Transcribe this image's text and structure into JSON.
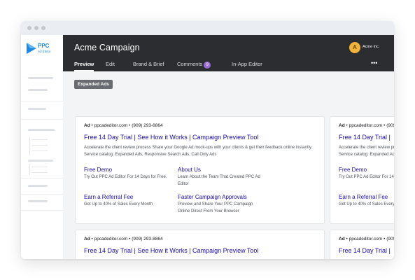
{
  "window": {
    "dots": [
      "dot",
      "dot",
      "dot"
    ]
  },
  "sidebar": {
    "logo": {
      "text_top": "PPC",
      "text_bottom": "Ad Editor",
      "brand_color": "#1e88e5"
    }
  },
  "header": {
    "title": "Acme Campaign",
    "brand": {
      "name": "Acme Inc.",
      "logo_color": "#f2b33a"
    },
    "more_label": "•••",
    "tabs": [
      {
        "label": "Preview",
        "active": true
      },
      {
        "label": "Edit"
      },
      {
        "label": "Brand & Brief"
      },
      {
        "label": "Comments",
        "badge": "9"
      },
      {
        "label": "In-App Editor"
      }
    ]
  },
  "content": {
    "section_chip": "Expanded Ads",
    "ad": {
      "ad_label": "Ad",
      "separator": "•",
      "url": "ppcadeditor.com",
      "phone": "(909) 293-8864",
      "headline": "Free 14 Day Trial | See How it Works | Campaign Preview Tool",
      "description": "Accelerate the client review process Share your Google Ad mock-ups with your clients & get their feedback online instantly. Service catalog: Expanded Ads, Responsive Search Ads, Call Only Ads",
      "sitelinks": [
        {
          "title": "Free Demo",
          "text": "Try Out PPC Ad Editor For 14 Days for Free."
        },
        {
          "title": "About Us",
          "text": "Learn About the Team That Created PPC Ad Editor"
        },
        {
          "title": "Earn a Referral Fee",
          "text": "Get Up to 40% of Sales Every Month"
        },
        {
          "title": "Faster Campaign Approvals",
          "text": "Preview and Share Your PPC Campaign Online Direct From Your Browser"
        }
      ]
    },
    "ad_partial_headline": "Free 14 Day Trial |",
    "ad_partial_desc": "Accelerate the client review process Share your Google Ad mock-ups with your clients & get their feedback online instantly. Service catalog: Expanded Ads, Responsive Search Ads, Call Only Ads"
  },
  "colors": {
    "header_bg": "#2b2d30",
    "headline_blue": "#1a0dab",
    "badge_purple": "#9b6bd6",
    "chip_bg": "#686b70"
  }
}
